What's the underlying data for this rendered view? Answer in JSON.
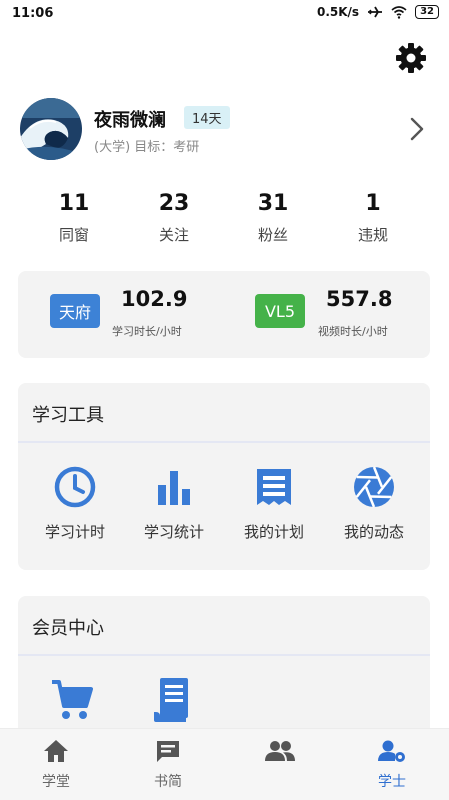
{
  "status_bar": {
    "time": "11:06",
    "speed": "0.5K/s",
    "battery": "32"
  },
  "profile": {
    "name": "夜雨微澜",
    "days_badge": "14天",
    "subtitle": "(大学) 目标：考研"
  },
  "stats": [
    {
      "value": "11",
      "label": "同窗"
    },
    {
      "value": "23",
      "label": "关注"
    },
    {
      "value": "31",
      "label": "粉丝"
    },
    {
      "value": "1",
      "label": "违规"
    }
  ],
  "durations": {
    "study": {
      "tag": "天府",
      "value": "102.9",
      "label": "学习时长/小时"
    },
    "video": {
      "tag": "VL5",
      "value": "557.8",
      "label": "视频时长/小时"
    }
  },
  "tools": {
    "title": "学习工具",
    "items": [
      {
        "label": "学习计时",
        "icon": "clock-icon"
      },
      {
        "label": "学习统计",
        "icon": "bar-chart-icon"
      },
      {
        "label": "我的计划",
        "icon": "plan-icon"
      },
      {
        "label": "我的动态",
        "icon": "aperture-icon"
      }
    ]
  },
  "membership": {
    "title": "会员中心",
    "items": [
      {
        "icon": "cart-icon"
      },
      {
        "icon": "receipt-icon"
      }
    ]
  },
  "bottom_nav": [
    {
      "label": "学堂",
      "icon": "home-icon"
    },
    {
      "label": "书简",
      "icon": "message-icon"
    },
    {
      "label": "",
      "icon": "group-icon"
    },
    {
      "label": "学士",
      "icon": "user-settings-icon",
      "active": true
    }
  ],
  "colors": {
    "accent": "#3d82d6",
    "green": "#45b249",
    "icon_blue": "#3a7bd5"
  }
}
